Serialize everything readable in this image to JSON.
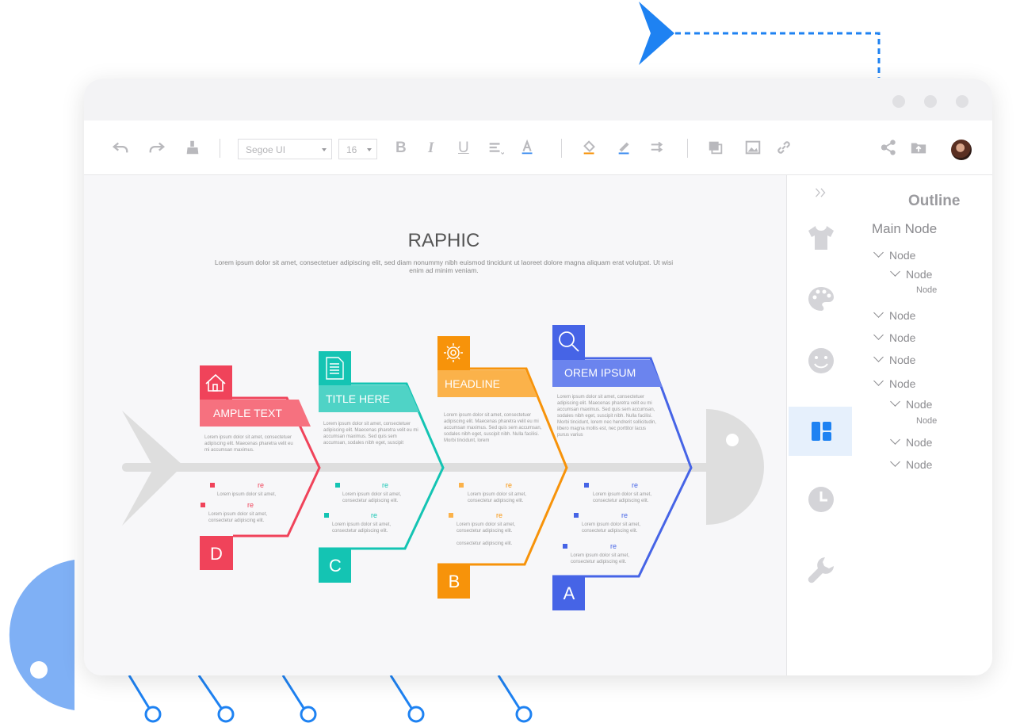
{
  "toolbar": {
    "font_name": "Segoe UI",
    "font_size": "16"
  },
  "diagram": {
    "title": "RAPHIC",
    "subtitle_line1": "Lorem ipsum dolor sit amet, consectetuer adipiscing elit, sed diam nonummy nibh euismod tincidunt ut laoreet dolore magna aliquam erat volutpat. Ut wisi",
    "subtitle_line2": "enim ad minim veniam.",
    "branches": [
      {
        "label": "AMPLE TEXT",
        "letter": "D",
        "color": "#f0435a",
        "light": "#f6717f"
      },
      {
        "label": "TITLE HERE",
        "letter": "C",
        "color": "#14c4b3",
        "light": "#4fd3c6"
      },
      {
        "label": "HEADLINE",
        "letter": "B",
        "color": "#f7930a",
        "light": "#fbb24a"
      },
      {
        "label": "OREM IPSUM",
        "letter": "A",
        "color": "#4664e6",
        "light": "#6b84ee"
      }
    ],
    "body_lines": [
      [
        "Lorem ipsum dolor sit amet, consectetuer",
        "adipiscing elit. Maecenas pharetra velit eu",
        "mi accumsan maximus."
      ],
      [
        "Lorem ipsum dolor sit amet, consectetuer",
        "adipiscing elit. Maecenas pharetra velit eu mi",
        "accumsan maximus. Sed quis sem",
        "accumsan, sodales nibh eget, suscipit"
      ],
      [
        "Lorem ipsum dolor sit amet, consectetuer",
        "adipiscing elit. Maecenas pharetra velit eu mi",
        "accumsan maximus. Sed quis sem accumsan,",
        "sodales nibh eget, suscipit nibh. Nulla facilisi.",
        "Morbi tincidunt, lorem"
      ],
      [
        "Lorem ipsum dolor sit amet, consectetuer",
        "adipiscing elit. Maecenas pharetra velit eu mi",
        "accumsan maximus. Sed quis sem accumsan,",
        "sodales nibh eget, suscipit nibh. Nulla facilisi.",
        "Morbi tincidunt, lorem nec hendrerit sollicitudin,",
        "libero magna mollis est, nec porttitor lacus",
        "purus varius"
      ]
    ],
    "item_re": "re",
    "item_line1": "Lorem ipsum dolor sit amet,",
    "item_line2": "consectetur adipiscing elit."
  },
  "outline": {
    "title": "Outline",
    "main_node": "Main Node",
    "node": "Node"
  },
  "colors": {
    "accent_blue": "#1e82f2",
    "spine": "#dedede"
  }
}
